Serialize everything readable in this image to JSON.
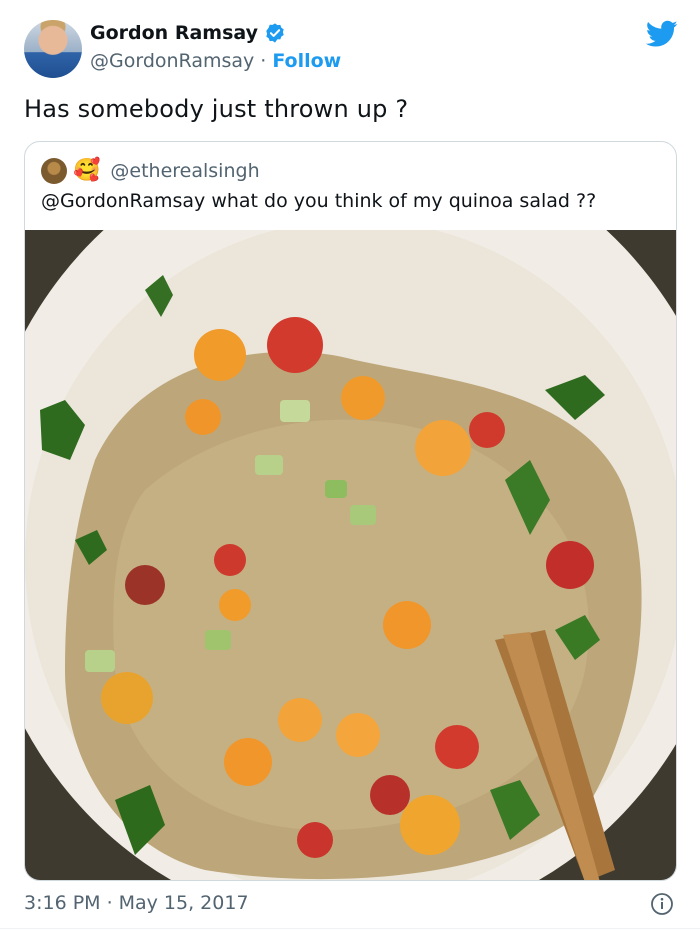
{
  "author": {
    "display_name": "Gordon Ramsay",
    "handle": "@GordonRamsay",
    "separator": "·",
    "follow_label": "Follow",
    "verified": true
  },
  "tweet": {
    "text": "Has somebody just thrown up ?",
    "time": "3:16 PM",
    "separator": "·",
    "date": "May 15, 2017"
  },
  "quoted_tweet": {
    "emoji": "🥰",
    "handle": "@etherealsingh",
    "text": "@GordonRamsay what do you think of my quinoa salad ??",
    "photo_icon": "quinoa-salad-photo"
  },
  "colors": {
    "accent": "#1d9bf0",
    "text": "#0f1419",
    "muted": "#536471",
    "border": "#cfd9de"
  }
}
